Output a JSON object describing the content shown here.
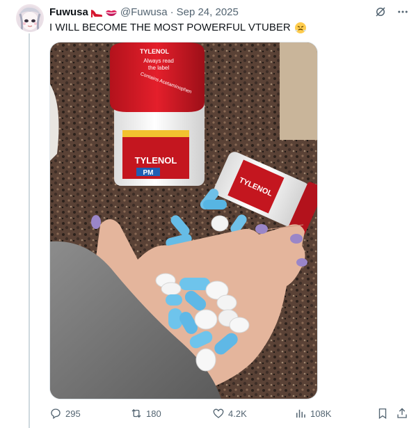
{
  "tweet": {
    "author_name": "Fuwusa",
    "author_emojis": [
      "high-heel-icon",
      "kiss-mark-icon"
    ],
    "handle": "@Fuwusa",
    "separator": "·",
    "date": "Sep 24, 2025",
    "text": "I WILL BECOME THE MOST POWERFUL VTUBER",
    "text_emoji": "steam-face-icon",
    "media": {
      "bottle_cap_text": [
        "TYLENOL",
        "Always read",
        "the label",
        "Contains Acetaminophen"
      ],
      "bottle_label_brand": "TYLENOL",
      "bottle_label_sub": "PM",
      "second_bottle_brand": "TYLENOL"
    }
  },
  "metrics": {
    "replies": "295",
    "reposts": "180",
    "likes": "4.2K",
    "views": "108K"
  },
  "colors": {
    "text_primary": "#0f1419",
    "text_secondary": "#536471",
    "border": "#cfd9de"
  }
}
